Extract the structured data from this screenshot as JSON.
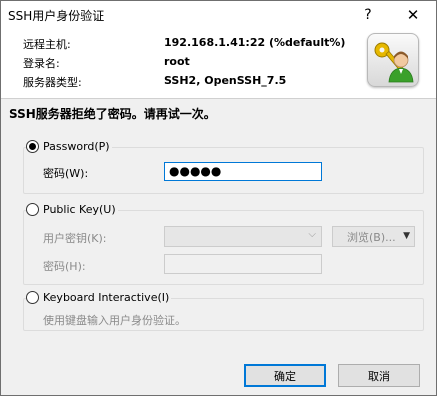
{
  "title": "SSH用户身份验证",
  "title_buttons": {
    "help": "?",
    "close": "✕"
  },
  "info": {
    "host_label": "远程主机:",
    "host_value": "192.168.1.41:22 (%default%)",
    "user_label": "登录名:",
    "user_value": "root",
    "server_label": "服务器类型:",
    "server_value": "SSH2, OpenSSH_7.5"
  },
  "icon": "keys-user-icon",
  "error_message": "SSH服务器拒绝了密码。请再试一次。",
  "password_method": {
    "label": "Password(P)",
    "selected": true,
    "field_label": "密码(W):",
    "value": "●●●●●"
  },
  "publickey_method": {
    "label": "Public Key(U)",
    "selected": false,
    "key_label": "用户密钥(K):",
    "key_value": "",
    "browse_label": "浏览(B)...",
    "passphrase_label": "密码(H):",
    "passphrase_value": ""
  },
  "keyboard_method": {
    "label": "Keyboard Interactive(I)",
    "selected": false,
    "description": "使用键盘输入用户身份验证。"
  },
  "buttons": {
    "ok": "确定",
    "cancel": "取消"
  },
  "colors": {
    "accent": "#0078d7",
    "background": "#f0f0f0",
    "disabled_text": "#8a8a8a"
  }
}
